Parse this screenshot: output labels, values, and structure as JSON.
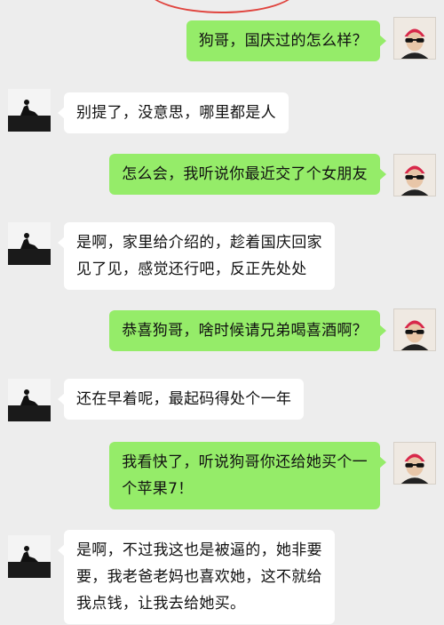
{
  "conversation": {
    "messages": [
      {
        "side": "right",
        "lines": [
          "狗哥，国庆过的怎么样？"
        ]
      },
      {
        "side": "left",
        "lines": [
          "别提了，没意思，哪里都是人"
        ]
      },
      {
        "side": "right",
        "lines": [
          "怎么会，我听说你最近交了个女朋友"
        ]
      },
      {
        "side": "left",
        "lines": [
          "是啊，家里给介绍的，趁着国庆回家",
          "见了见，感觉还行吧，反正先处处"
        ]
      },
      {
        "side": "right",
        "lines": [
          "恭喜狗哥，啥时候请兄弟喝喜酒啊？"
        ]
      },
      {
        "side": "left",
        "lines": [
          "还在早着呢，最起码得处个一年"
        ]
      },
      {
        "side": "right",
        "lines": [
          "我看快了，听说狗哥你还给她买个一",
          "个苹果7！"
        ]
      },
      {
        "side": "left",
        "lines": [
          "是啊，不过我这也是被逼的，她非要",
          "要，我老爸老妈也喜欢她，这不就给",
          "我点钱，让我去给她买。"
        ]
      }
    ]
  },
  "colors": {
    "background": "#ededed",
    "sent_bubble": "#95ec69",
    "received_bubble": "#ffffff",
    "annotation_circle": "#e0443e"
  },
  "icons": {
    "sender_avatar": "avatar-red-hat-sunglasses",
    "receiver_avatar": "avatar-silhouette-sitting"
  }
}
